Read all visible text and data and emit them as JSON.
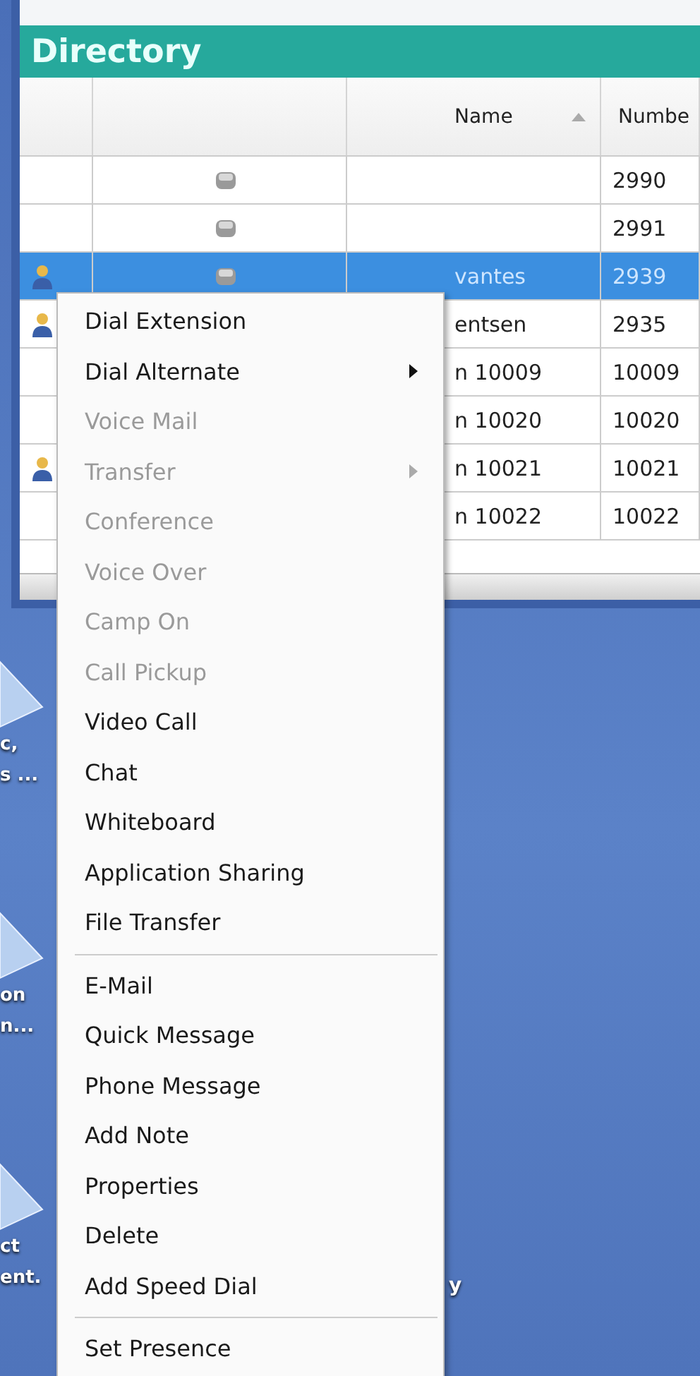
{
  "window": {
    "title": "Directory"
  },
  "table": {
    "columns": [
      {},
      {},
      {
        "label": "Name",
        "sorted": true
      },
      {
        "label": "Numbe"
      }
    ],
    "rows": [
      {
        "selected": false,
        "contact_icon": false,
        "status_icon": true,
        "name": "",
        "number": "2990"
      },
      {
        "selected": false,
        "contact_icon": false,
        "status_icon": true,
        "name": "",
        "number": "2991"
      },
      {
        "selected": true,
        "contact_icon": true,
        "status_icon": true,
        "name": "vantes",
        "number": "2939"
      },
      {
        "selected": false,
        "contact_icon": true,
        "name": "entsen",
        "number": "2935"
      },
      {
        "selected": false,
        "contact_icon": false,
        "name": "n 10009",
        "number": "10009"
      },
      {
        "selected": false,
        "contact_icon": false,
        "name": "n 10020",
        "number": "10020"
      },
      {
        "selected": false,
        "contact_icon": true,
        "name": "n 10021",
        "number": "10021"
      },
      {
        "selected": false,
        "contact_icon": false,
        "name": "n 10022",
        "number": "10022"
      }
    ]
  },
  "desktop_icons": [
    {
      "lines": [
        "c,",
        "s ..."
      ]
    },
    {
      "lines": [
        "on",
        "n..."
      ]
    },
    {
      "lines": [
        "ct",
        "ent."
      ]
    }
  ],
  "desktop_fragment": "y",
  "context_menu": [
    {
      "kind": "item",
      "label": "Dial Extension",
      "disabled": false,
      "submenu": false
    },
    {
      "kind": "item",
      "label": "Dial Alternate",
      "disabled": false,
      "submenu": true
    },
    {
      "kind": "item",
      "label": "Voice Mail",
      "disabled": true,
      "submenu": false
    },
    {
      "kind": "item",
      "label": "Transfer",
      "disabled": true,
      "submenu": true
    },
    {
      "kind": "item",
      "label": "Conference",
      "disabled": true,
      "submenu": false
    },
    {
      "kind": "item",
      "label": "Voice Over",
      "disabled": true,
      "submenu": false
    },
    {
      "kind": "item",
      "label": "Camp On",
      "disabled": true,
      "submenu": false
    },
    {
      "kind": "item",
      "label": "Call Pickup",
      "disabled": true,
      "submenu": false
    },
    {
      "kind": "item",
      "label": "Video Call",
      "disabled": false,
      "submenu": false
    },
    {
      "kind": "item",
      "label": "Chat",
      "disabled": false,
      "submenu": false
    },
    {
      "kind": "item",
      "label": "Whiteboard",
      "disabled": false,
      "submenu": false
    },
    {
      "kind": "item",
      "label": "Application Sharing",
      "disabled": false,
      "submenu": false
    },
    {
      "kind": "item",
      "label": "File Transfer",
      "disabled": false,
      "submenu": false
    },
    {
      "kind": "separator"
    },
    {
      "kind": "item",
      "label": "E-Mail",
      "disabled": false,
      "submenu": false
    },
    {
      "kind": "item",
      "label": "Quick Message",
      "disabled": false,
      "submenu": false
    },
    {
      "kind": "item",
      "label": "Phone Message",
      "disabled": false,
      "submenu": false
    },
    {
      "kind": "item",
      "label": "Add Note",
      "disabled": false,
      "submenu": false
    },
    {
      "kind": "item",
      "label": "Properties",
      "disabled": false,
      "submenu": false
    },
    {
      "kind": "item",
      "label": "Delete",
      "disabled": false,
      "submenu": false
    },
    {
      "kind": "item",
      "label": "Add Speed Dial",
      "disabled": false,
      "submenu": false
    },
    {
      "kind": "separator"
    },
    {
      "kind": "item",
      "label": "Set Presence",
      "disabled": false,
      "submenu": false
    }
  ]
}
